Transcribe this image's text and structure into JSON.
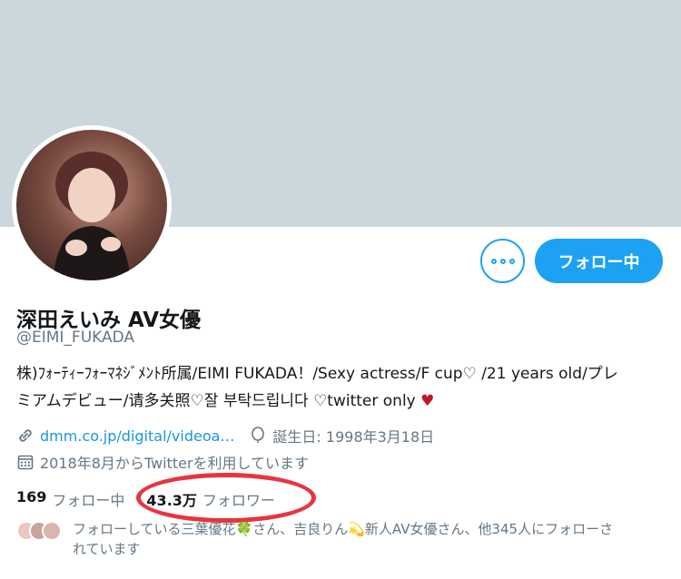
{
  "profile": {
    "display_name": "深田えいみ AV女優",
    "handle": "@EIMI_FUKADA",
    "bio_line1": "株)ﾌｫｰﾃｨｰﾌｫｰﾏﾈｼﾞﾒﾝﾄ所属/EIMI FUKADA！/Sexy actress/F cup♡ /21 years old/プレ",
    "bio_line2": "ミアムデビュー/请多关照♡잘 부탁드립니다 ♡twitter only",
    "bio_heart": "♥",
    "website": "dmm.co.jp/digital/videoa…",
    "birthday": "誕生日: 1998年3月18日",
    "joined": "2018年8月からTwitterを利用しています"
  },
  "actions": {
    "follow_label": "フォロー中",
    "more_icon": "ellipsis-icon"
  },
  "stats": {
    "following_count": "169",
    "following_label": "フォロー中",
    "followers_count": "43.3万",
    "followers_label": "フォロワー"
  },
  "followed_by": {
    "text_line1": "フォローしている三葉優花🍀さん、吉良りん💫新人AV女優さん、他345人にフォローさ",
    "text_line2": "れています"
  },
  "colors": {
    "accent": "#1da1f2",
    "banner": "#ccd6dd",
    "annotation": "#e8343f"
  }
}
